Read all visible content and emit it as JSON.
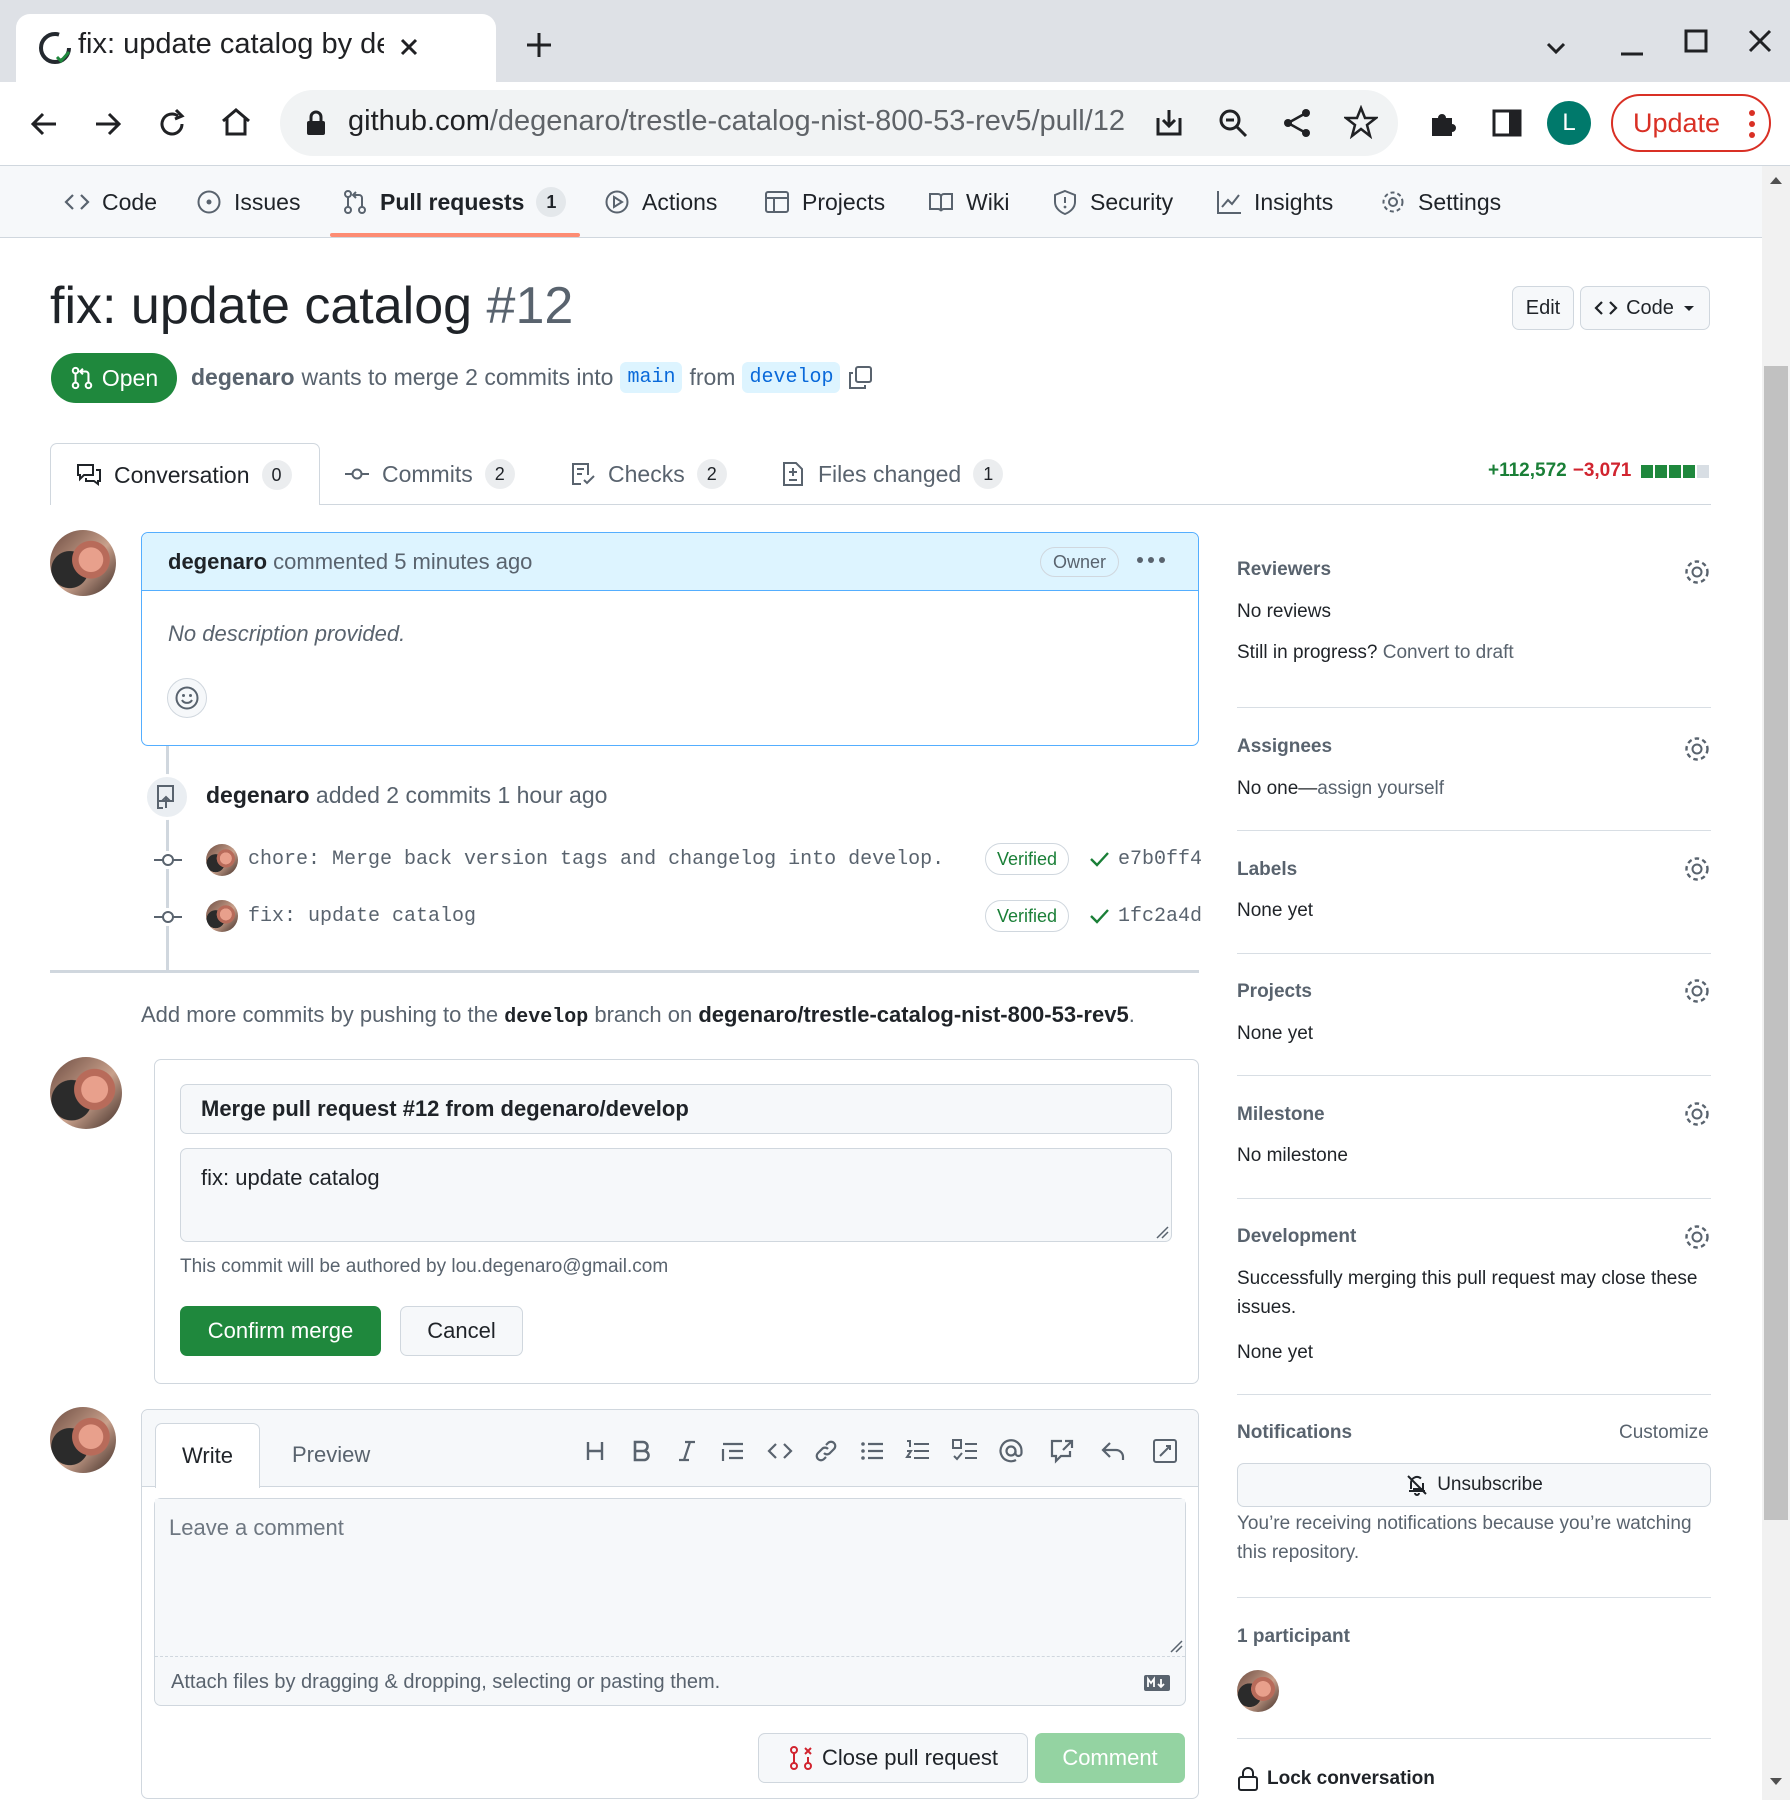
{
  "browser": {
    "tab_title": "fix: update catalog by dege",
    "url_domain": "github.com",
    "url_path": "/degenaro/trestle-catalog-nist-800-53-rev5/pull/12",
    "profile_initial": "L",
    "update_label": "Update"
  },
  "repo_nav": {
    "code": "Code",
    "issues": "Issues",
    "pulls": "Pull requests",
    "pulls_count": "1",
    "actions": "Actions",
    "projects": "Projects",
    "wiki": "Wiki",
    "security": "Security",
    "insights": "Insights",
    "settings": "Settings"
  },
  "pr": {
    "title": "fix: update catalog",
    "number": "#12",
    "edit_label": "Edit",
    "code_label": "Code",
    "state": "Open",
    "author": "degenaro",
    "merge_text": "wants to merge 2 commits into",
    "base_branch": "main",
    "from_text": "from",
    "head_branch": "develop"
  },
  "pr_tabs": {
    "conversation": "Conversation",
    "conversation_count": "0",
    "commits": "Commits",
    "commits_count": "2",
    "checks": "Checks",
    "checks_count": "2",
    "files": "Files changed",
    "files_count": "1",
    "additions": "+112,572",
    "deletions": "−3,071"
  },
  "comment": {
    "author": "degenaro",
    "meta": "commented 5 minutes ago",
    "role": "Owner",
    "body": "No description provided."
  },
  "timeline": {
    "author": "degenaro",
    "event": "added 2 commits 1 hour ago",
    "commits": [
      {
        "message": "chore: Merge back version tags and changelog into develop.",
        "badge": "Verified",
        "sha": "e7b0ff4"
      },
      {
        "message": "fix: update catalog",
        "badge": "Verified",
        "sha": "1fc2a4d"
      }
    ]
  },
  "push_hint": {
    "prefix": "Add more commits by pushing to the",
    "branch": "develop",
    "middle": "branch on",
    "repo": "degenaro/trestle-catalog-nist-800-53-rev5",
    "suffix": "."
  },
  "merge_box": {
    "title_value": "Merge pull request #12 from degenaro/develop",
    "body_value": "fix: update catalog",
    "author_note": "This commit will be authored by lou.degenaro@gmail.com",
    "confirm_label": "Confirm merge",
    "cancel_label": "Cancel"
  },
  "comment_box": {
    "write_tab": "Write",
    "preview_tab": "Preview",
    "placeholder": "Leave a comment",
    "attach_hint": "Attach files by dragging & dropping, selecting or pasting them.",
    "close_label": "Close pull request",
    "comment_label": "Comment"
  },
  "sidebar": {
    "reviewers": {
      "heading": "Reviewers",
      "value": "No reviews",
      "draft_prefix": "Still in progress?",
      "draft_link": "Convert to draft"
    },
    "assignees": {
      "heading": "Assignees",
      "value": "No one—",
      "assign_link": "assign yourself"
    },
    "labels": {
      "heading": "Labels",
      "value": "None yet"
    },
    "projects": {
      "heading": "Projects",
      "value": "None yet"
    },
    "milestone": {
      "heading": "Milestone",
      "value": "No milestone"
    },
    "development": {
      "heading": "Development",
      "line1": "Successfully merging this pull request may close these",
      "line2": "issues.",
      "value": "None yet"
    },
    "notifications": {
      "heading": "Notifications",
      "customize": "Customize",
      "unsubscribe": "Unsubscribe",
      "reason_line1": "You’re receiving notifications because you’re watching",
      "reason_line2": "this repository."
    },
    "participants": {
      "heading": "1 participant"
    },
    "lock": "Lock conversation"
  },
  "colors": {
    "open_green": "#1f883d",
    "link_blue": "#0969da",
    "danger_red": "#d1242f",
    "comment_header_bg": "#ddf4ff",
    "tab_underline": "#fd8c73"
  }
}
